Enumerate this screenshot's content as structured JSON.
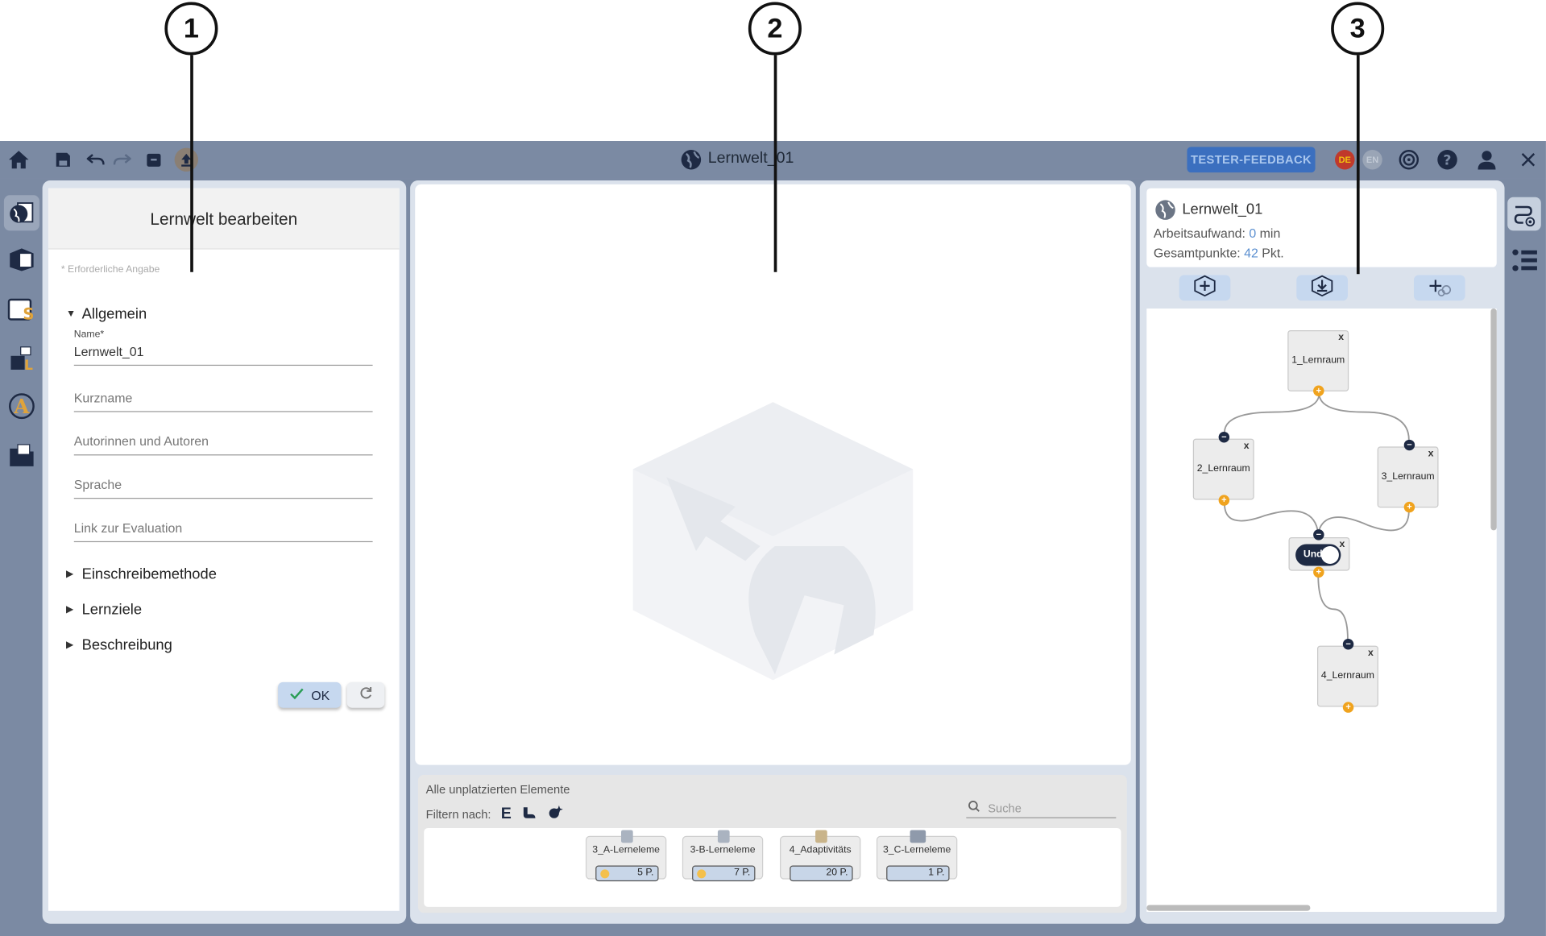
{
  "callouts": [
    "1",
    "2",
    "3"
  ],
  "toolbar": {
    "title": "Lernwelt_01",
    "feedback_label": "TESTER-FEEDBACK",
    "lang_de": "DE",
    "lang_en": "EN",
    "icons": [
      "home-icon",
      "save-icon",
      "undo-icon",
      "redo-icon",
      "archive-icon",
      "upload-icon",
      "globe-icon",
      "target-icon",
      "help-icon",
      "user-icon",
      "close-icon"
    ]
  },
  "left_rail": {
    "icons": [
      "world-icon",
      "room-icon",
      "space-icon",
      "element-icon",
      "adaptivity-icon",
      "folder-icon"
    ]
  },
  "edit_panel": {
    "title": "Lernwelt bearbeiten",
    "hint": "* Erforderliche Angabe",
    "section_general": "Allgemein",
    "name_label": "Name*",
    "name_value": "Lernwelt_01",
    "short_name_placeholder": "Kurzname",
    "authors_placeholder": "Autorinnen und Autoren",
    "language_placeholder": "Sprache",
    "evaluation_placeholder": "Link zur Evaluation",
    "section_enrolment": "Einschreibemethode",
    "section_goals": "Lernziele",
    "section_description": "Beschreibung",
    "ok_label": "OK"
  },
  "unplaced": {
    "title": "Alle unplatzierten Elemente",
    "filter_label": "Filtern nach:",
    "filter_e": "E",
    "search_placeholder": "Suche",
    "elements": [
      {
        "name": "3_A-Lerneleme",
        "points": "5 P.",
        "dot": true
      },
      {
        "name": "3-B-Lerneleme",
        "points": "7 P.",
        "dot": true
      },
      {
        "name": "4_Adaptivitäts",
        "points": "20 P.",
        "dot": false
      },
      {
        "name": "3_C-Lerneleme",
        "points": "1 P.",
        "dot": false
      }
    ]
  },
  "world_info": {
    "name": "Lernwelt_01",
    "workload_label": "Arbeitsaufwand:",
    "workload_value": "0",
    "workload_unit": "min",
    "points_label": "Gesamtpunkte:",
    "points_value": "42",
    "points_unit": "Pkt."
  },
  "graph": {
    "rooms": [
      "1_Lernraum",
      "2_Lernraum",
      "3_Lernraum",
      "4_Lernraum"
    ],
    "condition_label": "Und",
    "close_label": "x"
  },
  "colors": {
    "accent": "#3b6fbf",
    "bar": "#7b8aa3",
    "dark": "#1e2a44",
    "orange": "#f0a31e"
  }
}
